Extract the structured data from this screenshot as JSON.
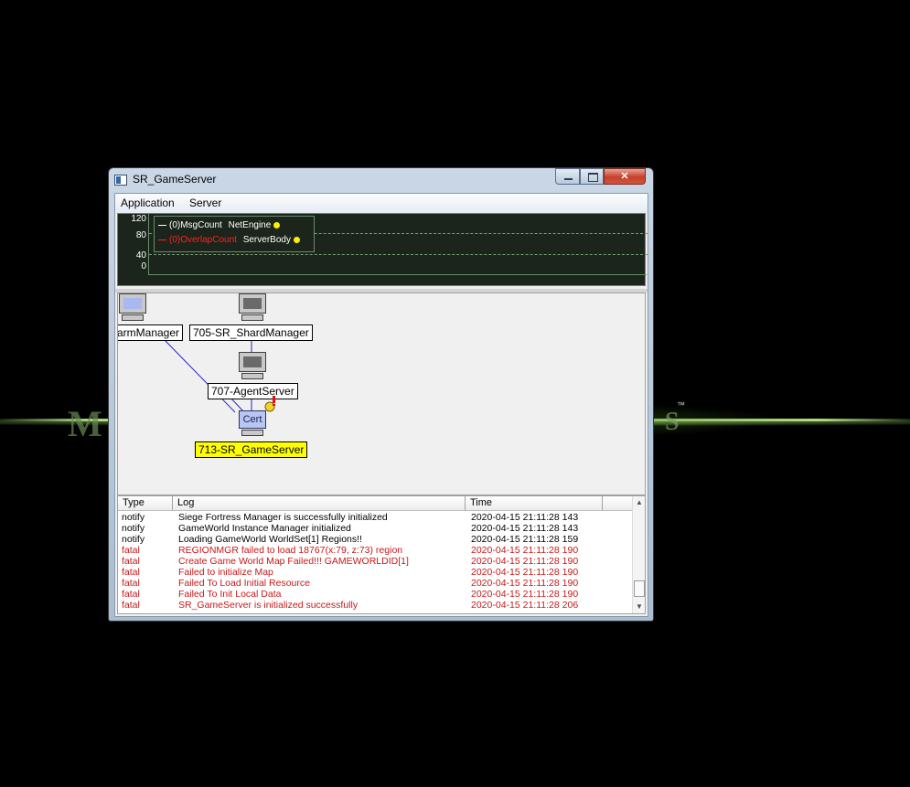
{
  "window": {
    "title": "SR_GameServer",
    "controls": {
      "minimize": "minimize",
      "maximize": "maximize",
      "close": "✕"
    }
  },
  "menu": [
    "Application",
    "Server"
  ],
  "graph": {
    "ticks": [
      "120",
      "80",
      "40",
      "0"
    ],
    "legend": [
      {
        "label": "(0)MsgCount",
        "source": "NetEngine",
        "color": "#ffffff"
      },
      {
        "label": "(0)OverlapCount",
        "source": "ServerBody",
        "color": "#ff2020"
      }
    ]
  },
  "topology": {
    "nodes": {
      "farm": "armManager",
      "shard": "705-SR_ShardManager",
      "agent": "707-AgentServer",
      "game": "713-SR_GameServer",
      "cert_caption": "Cert"
    }
  },
  "log": {
    "columns": {
      "type": "Type",
      "log": "Log",
      "time": "Time"
    },
    "rows": [
      {
        "type": "notify",
        "log": "Siege Fortress Manager is successfully initialized",
        "time": "2020-04-15 21:11:28 143"
      },
      {
        "type": "notify",
        "log": "GameWorld Instance Manager initialized",
        "time": "2020-04-15 21:11:28 143"
      },
      {
        "type": "notify",
        "log": "Loading GameWorld WorldSet[1] Regions!!",
        "time": "2020-04-15 21:11:28 159"
      },
      {
        "type": "fatal",
        "log": "REGIONMGR failed to load 18767(x:79, z:73) region",
        "time": "2020-04-15 21:11:28 190"
      },
      {
        "type": "fatal",
        "log": "Create Game World Map Failed!!! GAMEWORLDID[1]",
        "time": "2020-04-15 21:11:28 190"
      },
      {
        "type": "fatal",
        "log": "Failed to initialize Map",
        "time": "2020-04-15 21:11:28 190"
      },
      {
        "type": "fatal",
        "log": "Failed To Load Initial Resource",
        "time": "2020-04-15 21:11:28 190"
      },
      {
        "type": "fatal",
        "log": "Failed To Init Local Data",
        "time": "2020-04-15 21:11:28 190"
      },
      {
        "type": "fatal",
        "log": "SR_GameServer is initialized successfully",
        "time": "2020-04-15 21:11:28 206"
      }
    ]
  },
  "colors": {
    "fatal": "#c81818",
    "highlight": "#ffff00",
    "graph_bg": "#1b251b"
  },
  "icons": [
    "app-icon",
    "computer-icon",
    "cert-computer-icon",
    "alert-icon"
  ],
  "wallpaper": {
    "tm": "™"
  }
}
